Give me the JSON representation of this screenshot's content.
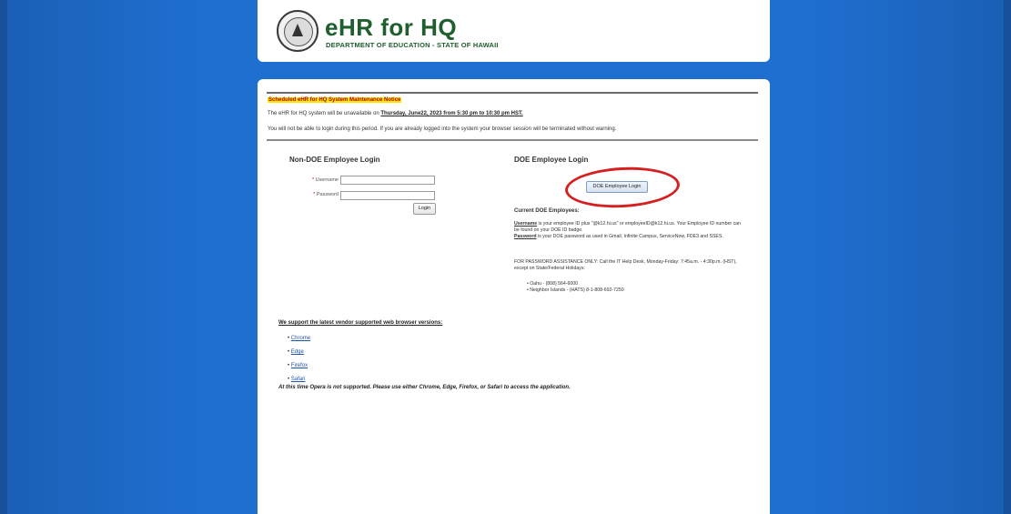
{
  "header": {
    "title": "eHR for HQ",
    "subtitle": "DEPARTMENT OF EDUCATION - STATE OF HAWAII",
    "seal_icon": "state-seal-icon"
  },
  "notice": {
    "title": "Scheduled eHR for HQ System Maintenance Notice",
    "line1_prefix": "The eHR for HQ system will be unavailable on ",
    "line1_date": "Thursday, June22, 2023 from 5:30 pm to 10:30 pm HST.",
    "line2": "You will not be able to login during this period. If you are already logged into the system your browser session will be terminated without warning."
  },
  "non_doe_login": {
    "heading": "Non-DOE Employee Login",
    "username_label": "Username",
    "password_label": "Password",
    "required_mark": "*",
    "username_value": "",
    "password_value": "",
    "login_button": "Login"
  },
  "doe_login": {
    "heading": "DOE Employee Login",
    "button": "DOE Employee Login",
    "current_heading": "Current DOE Employees:",
    "username_term": "Username",
    "username_text": " is your employee ID plus \"@k12.hi.us\" or employeeID@k12.hi.us. Your Employee ID number can be found on your DOE ID badge.",
    "password_term": "Password",
    "password_text": " is your DOE password as used in Gmail, Infinite Campus, ServiceNow, FDE3 and SSES.",
    "help_text": "FOR PASSWORD ASSISTANCE ONLY: Call the IT Help Desk, Monday-Friday: 7:45a.m. - 4:30p.m. (HST), except on State/Federal Holidays:",
    "phones": [
      "Oahu - (808) 564-6000",
      "Neighbor Islands - (HATS) 8-1-808-692-7250"
    ],
    "highlight_color": "#d62020"
  },
  "browsers": {
    "heading": "We support the latest vendor supported web browser versions:",
    "items": [
      "Chrome",
      "Edge",
      "Firefox",
      "Safari"
    ],
    "note": "At this time Opera is not supported. Please use either Chrome, Edge, Firefox, or Safari to access the application."
  },
  "colors": {
    "background": "#1f6fd0",
    "brand_green": "#1f5e2e",
    "notice_highlight": "#ffe600",
    "notice_text": "#b00000"
  }
}
